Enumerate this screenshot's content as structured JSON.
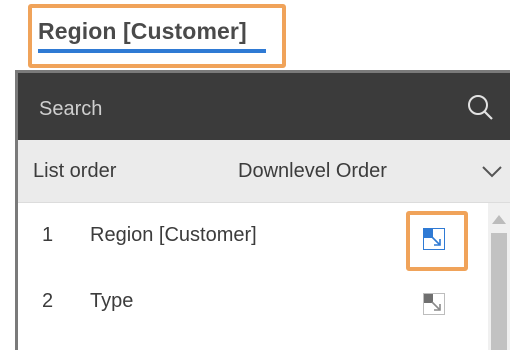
{
  "header": {
    "tab_label": "Region [Customer]"
  },
  "search": {
    "placeholder": "Search",
    "icon": "search-icon"
  },
  "list_order": {
    "label": "List order",
    "selected": "Downlevel Order",
    "icon": "chevron-down-icon"
  },
  "items": [
    {
      "number": "1",
      "label": "Region [Customer]",
      "icon": "drill-down-icon",
      "active": true
    },
    {
      "number": "2",
      "label": "Type",
      "icon": "drill-down-icon",
      "active": false
    }
  ],
  "colors": {
    "highlight": "#f0a35a",
    "accent": "#2f7ad4",
    "search_bar": "#3b3b3b",
    "order_row": "#ebebeb"
  }
}
